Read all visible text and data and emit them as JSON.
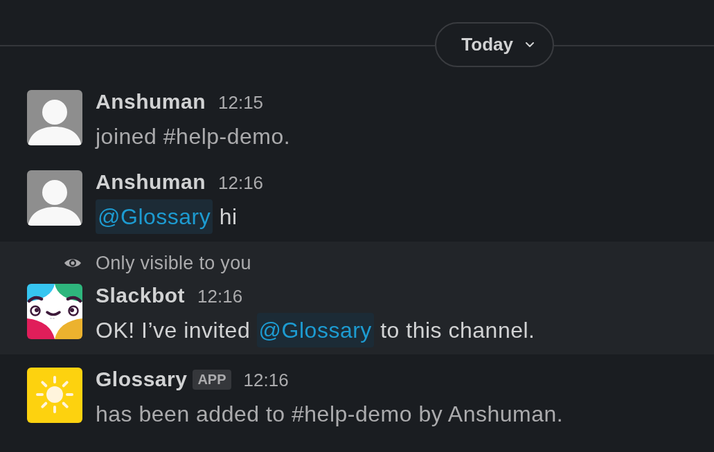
{
  "date_divider": {
    "label": "Today"
  },
  "messages": [
    {
      "kind": "user",
      "author": "Anshuman",
      "time": "12:15",
      "system": true,
      "highlighted": false,
      "body": [
        {
          "kind": "text",
          "text": "joined #help-demo."
        }
      ]
    },
    {
      "kind": "user",
      "author": "Anshuman",
      "time": "12:16",
      "system": false,
      "highlighted": false,
      "body": [
        {
          "kind": "mention",
          "text": "@Glossary"
        },
        {
          "kind": "text",
          "text": "hi"
        }
      ]
    },
    {
      "kind": "bot",
      "note": "Only visible to you",
      "author": "Slackbot",
      "time": "12:16",
      "system": false,
      "highlighted": true,
      "body": [
        {
          "kind": "text",
          "text": "OK! I’ve invited"
        },
        {
          "kind": "mention",
          "text": "@Glossary"
        },
        {
          "kind": "text",
          "text": "to this channel."
        }
      ]
    },
    {
      "kind": "app",
      "author": "Glossary",
      "badge": "APP",
      "time": "12:16",
      "system": true,
      "highlighted": false,
      "body": [
        {
          "kind": "text",
          "text": "has been added to #help-demo by Anshuman."
        }
      ]
    }
  ]
}
